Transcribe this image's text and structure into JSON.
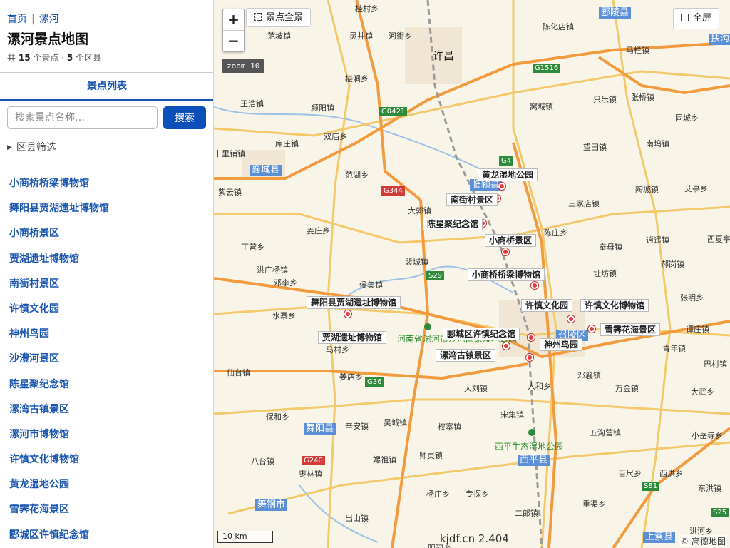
{
  "sidebar": {
    "breadcrumb": {
      "home": "首页",
      "current": "漯河"
    },
    "title": "漯河景点地图",
    "stats": {
      "prefix": "共",
      "spots": "15",
      "mid": "个景点 ·",
      "districts": "5",
      "suffix": "个区县"
    },
    "tab_label": "景点列表",
    "search": {
      "placeholder": "搜索景点名称…",
      "button": "搜索"
    },
    "filter_label": "区县筛选",
    "spots": [
      "小商桥桥梁博物馆",
      "舞阳县贾湖遗址博物馆",
      "小商桥景区",
      "贾湖遗址博物馆",
      "南街村景区",
      "许慎文化园",
      "神州鸟园",
      "沙澧河景区",
      "陈星聚纪念馆",
      "漯湾古镇景区",
      "漯河市博物馆",
      "许慎文化博物馆",
      "黄龙湿地公园",
      "雪霁花海景区",
      "郾城区许慎纪念馆"
    ]
  },
  "map": {
    "controls": {
      "zoom_in": "+",
      "zoom_out": "−",
      "overview": "景点全景",
      "fullscreen": "全屏",
      "zoom_level": "zoom 10"
    },
    "scale": "10 km",
    "footer": "kjdf.cn 2.404",
    "attribution": "© 高德地图",
    "pois": [
      "黄龙湿地公园",
      "南街村景区",
      "陈星聚纪念馆",
      "小商桥景区",
      "小商桥桥梁博物馆",
      "舞阳县贾湖遗址博物馆",
      "贾湖遗址博物馆",
      "许慎文化园",
      "许慎文化博物馆",
      "雪霁花海景区",
      "郾城区许慎纪念馆",
      "神州鸟园",
      "漯湾古镇景区"
    ],
    "cities": {
      "xuchang": "许昌"
    },
    "counties": [
      "襄城县",
      "临颍县",
      "舞阳县",
      "召陵区",
      "西平县",
      "舞钢市",
      "上蔡县",
      "郾陵县",
      "扶沟"
    ],
    "parks": [
      "河南省漯河市沙河国家湿地公园",
      "西平生态湿地公园"
    ],
    "roads": [
      "G0421",
      "G1516",
      "G4",
      "G344",
      "S29",
      "G36",
      "G240",
      "S81",
      "S25"
    ],
    "places": [
      "桂村乡",
      "河街乡",
      "灵井镇",
      "范坡镇",
      "椹涧乡",
      "王浩镇",
      "颍阳镇",
      "双庙乡",
      "库庄镇",
      "十里铺镇",
      "紫云镇",
      "范湖乡",
      "姜庄乡",
      "丁营乡",
      "洪庄杨镇",
      "邓李乡",
      "水寨乡",
      "侯集镇",
      "马村乡",
      "姜店乡",
      "仙台镇",
      "保和乡",
      "辛安镇",
      "吴城镇",
      "权寨镇",
      "师灵镇",
      "嫘祖镇",
      "八台镇",
      "枣林镇",
      "杨庄乡",
      "专探乡",
      "出山镇",
      "大郭镇",
      "裴城镇",
      "大刘镇",
      "人和乡",
      "宋集镇",
      "二郎镇",
      "陈化店镇",
      "马栏镇",
      "只乐镇",
      "张桥镇",
      "固城乡",
      "窝城镇",
      "望田镇",
      "南坞镇",
      "陶城镇",
      "艾亭乡",
      "三家店镇",
      "陈庄乡",
      "逍遥镇",
      "奉母镇",
      "郝岗镇",
      "址坊镇",
      "张明乡",
      "西夏亭镇",
      "谭庄镇",
      "青年镇",
      "巴村镇",
      "邓襄镇",
      "万金镇",
      "大武乡",
      "五沟营镇",
      "小岳寺乡",
      "百尺乡",
      "西洪乡",
      "东洪镇",
      "重渠乡",
      "洪河乡",
      "阴河乡"
    ]
  }
}
